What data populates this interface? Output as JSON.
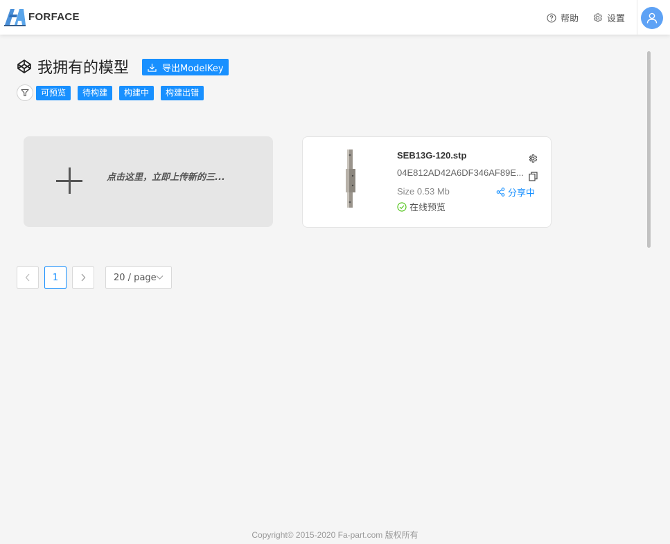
{
  "header": {
    "brand": "FORFACE",
    "help_label": "帮助",
    "settings_label": "设置"
  },
  "page": {
    "title": "我拥有的模型",
    "export_label": "导出ModelKey"
  },
  "filters": [
    {
      "label": "可预览"
    },
    {
      "label": "待构建"
    },
    {
      "label": "构建中"
    },
    {
      "label": "构建出错"
    }
  ],
  "upload": {
    "label": "点击这里，立即上传新的三..."
  },
  "models": [
    {
      "name": "SEB13G-120.stp",
      "hash": "04E812AD42A6DF346AF89E...",
      "size": "Size 0.53 Mb",
      "status": "在线预览",
      "share_label": "分享中"
    }
  ],
  "pagination": {
    "current_page": "1",
    "page_size": "20 / page"
  },
  "footer": "Copyright© 2015-2020 Fa-part.com 版权所有",
  "colors": {
    "primary": "#1890ff",
    "success": "#52c41a",
    "avatar": "#5ea2f5",
    "background": "#f5f5f5"
  },
  "icons": [
    "logo",
    "help-icon",
    "gear-icon",
    "user-icon",
    "codepen-icon",
    "download-icon",
    "filter-icon",
    "plus-icon",
    "gear-icon",
    "copy-icon",
    "share-icon",
    "check-circle-icon",
    "chevron-left-icon",
    "chevron-right-icon",
    "chevron-down-icon"
  ]
}
